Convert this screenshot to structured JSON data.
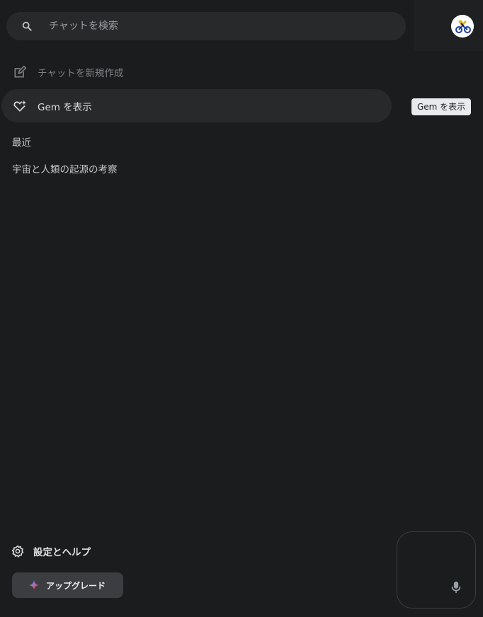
{
  "search": {
    "placeholder": "チャットを検索",
    "icon": "search-icon"
  },
  "sidebar": {
    "new_chat_label": "チャットを新規作成",
    "gem_label": "Gem を表示",
    "recent_title": "最近",
    "recent_items": [
      "宇宙と人類の起源の考察"
    ],
    "settings_label": "設定とヘルプ",
    "upgrade_label": "アップグレード"
  },
  "tooltip": {
    "text": "Gem を表示"
  },
  "colors": {
    "background": "#1b1c1d",
    "highlight": "#28292a",
    "upgrade_button": "#3c3d40",
    "tooltip_bg": "#e8eaed"
  }
}
